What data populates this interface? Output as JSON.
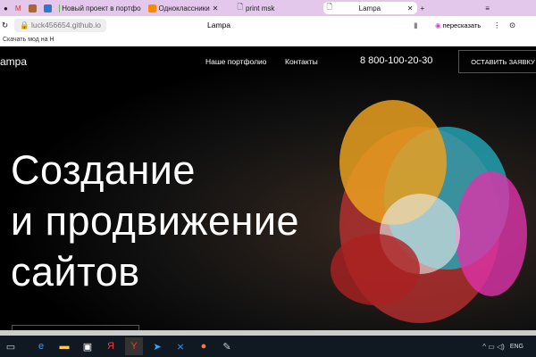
{
  "browser": {
    "tabs": [
      {
        "label": "Новый проект в портфо"
      },
      {
        "label": "Одноклассники"
      },
      {
        "label": "print msk"
      },
      {
        "label": "Lampa",
        "active": true
      }
    ],
    "address": "luck456654.github.io",
    "page_title": "Lampa",
    "retell_label": "пересказать",
    "bookmark": "Скачать мод на Н"
  },
  "site": {
    "logo": "ampa",
    "nav": [
      "Наше портфолио",
      "Контакты"
    ],
    "phone": "8 800-100-20-30",
    "cta": "ОСТАВИТЬ ЗАЯВКУ",
    "headline": [
      "Создание",
      "и продвижение",
      "сайтов"
    ]
  },
  "taskbar": {
    "lang": "ENG"
  },
  "colors": {
    "tabbar": "#e3c8ec",
    "taskbar": "#101822"
  }
}
